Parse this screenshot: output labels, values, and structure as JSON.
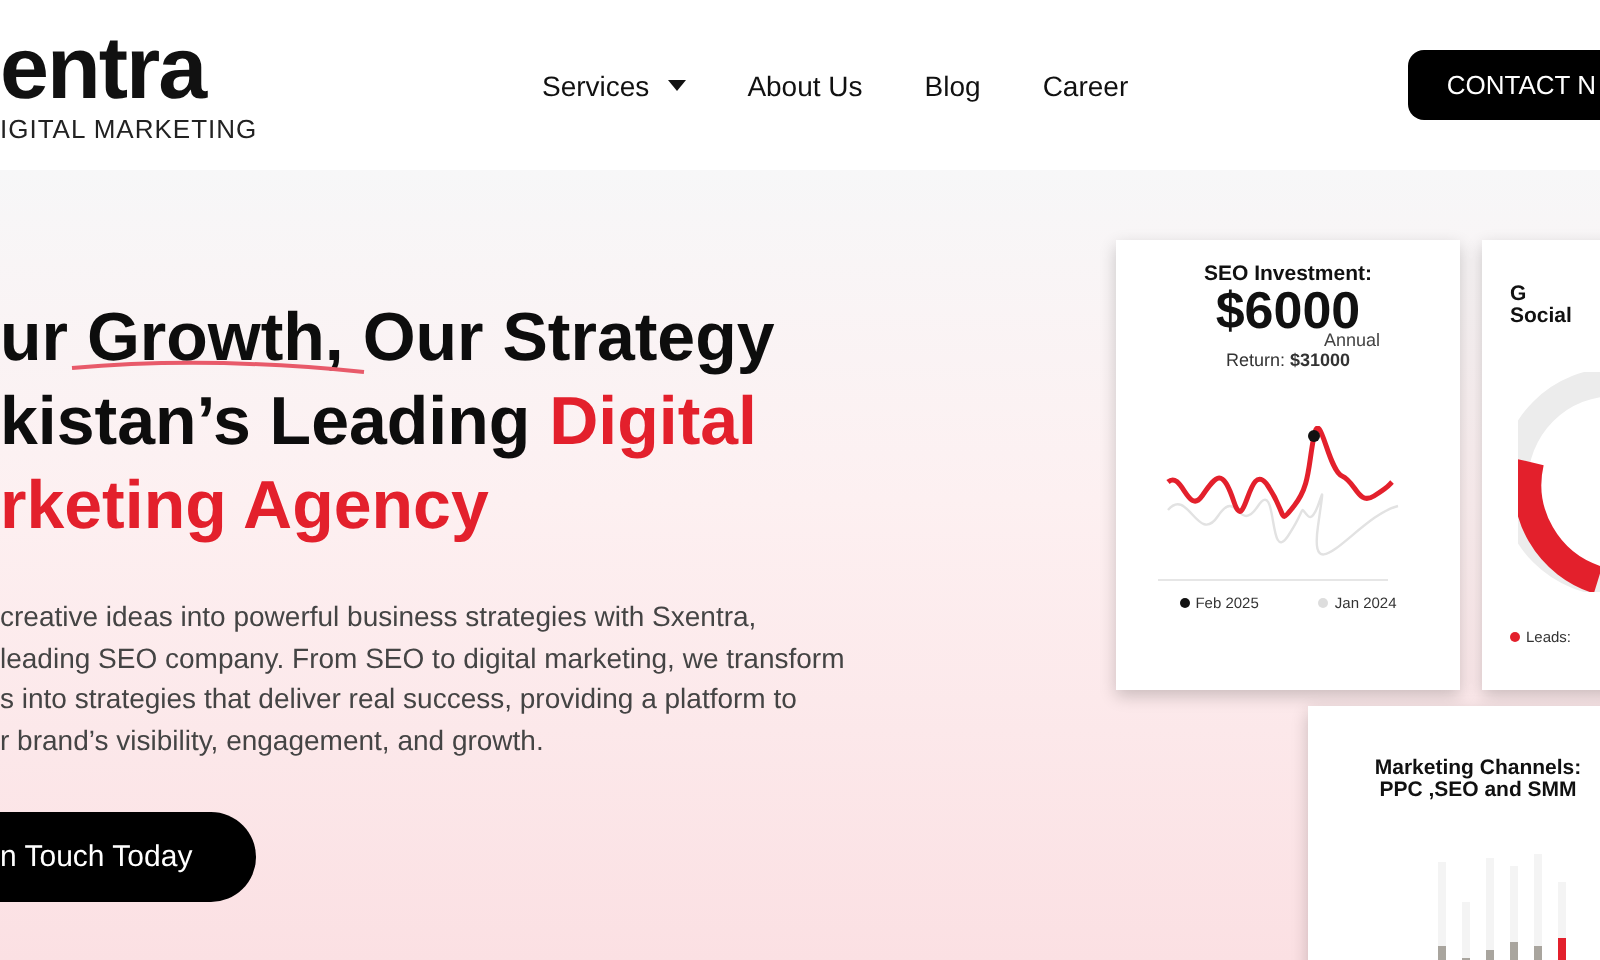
{
  "header": {
    "logo": "entra",
    "logo_tagline": "IGITAL MARKETING",
    "nav": [
      {
        "label": "Services",
        "dropdown": true
      },
      {
        "label": "About Us",
        "dropdown": false
      },
      {
        "label": "Blog",
        "dropdown": false
      },
      {
        "label": "Career",
        "dropdown": false
      }
    ],
    "cta": "CONTACT N"
  },
  "hero": {
    "headline": [
      {
        "text": "ur Growth, Our Strategy",
        "accent": false,
        "underline": true
      },
      {
        "text": "kistan’s Leading",
        "accent": false,
        "underline": false
      },
      {
        "text": "Digital",
        "accent": true,
        "underline": false
      },
      {
        "text": "rketing Agency",
        "accent": true,
        "underline": false
      }
    ],
    "paragraph_lines": [
      "creative ideas into powerful business strategies with Sxentra,",
      "leading SEO company. From SEO to digital marketing, we transform",
      "s into strategies that deliver real success, providing a platform to",
      "r brand’s visibility, engagement, and growth."
    ],
    "button": "n Touch Today"
  },
  "cards": [
    {
      "kind": "line",
      "title": "SEO Investment:",
      "amount": "$6000",
      "period": "Annual",
      "return_label": "Return:",
      "return_value": "$31000",
      "legend": [
        {
          "label": "Feb 2025",
          "color": "#111111"
        },
        {
          "label": "Jan 2024",
          "color": "#dddddd"
        }
      ]
    },
    {
      "kind": "donut",
      "title_lines": [
        "G",
        "Social"
      ],
      "legend": [
        {
          "label": "Leads:",
          "color": "#e3202c"
        }
      ]
    },
    {
      "kind": "bars",
      "title_lines": [
        "Marketing Channels:",
        "PPC ,SEO and SMM"
      ]
    }
  ]
}
